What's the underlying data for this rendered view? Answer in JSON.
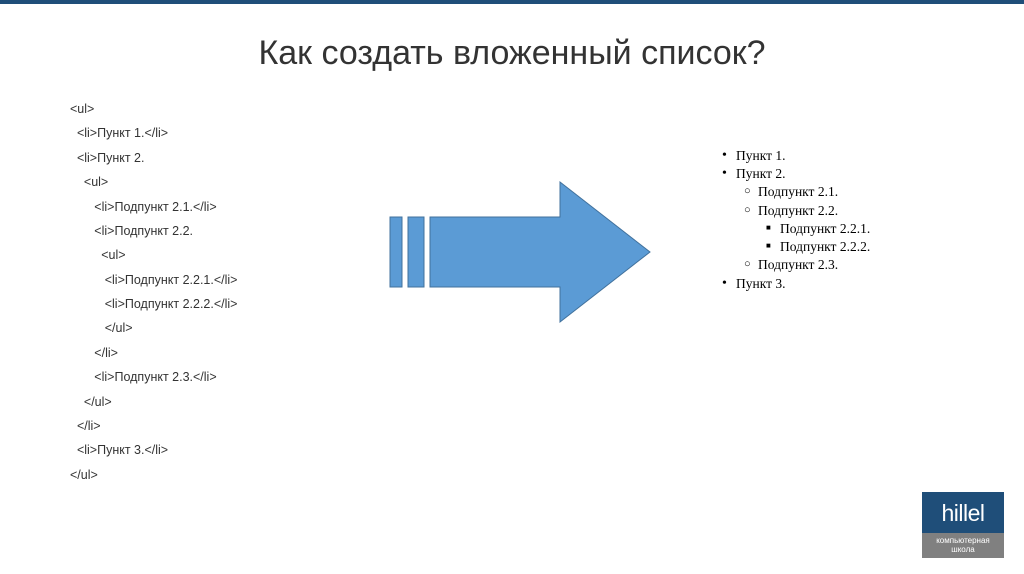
{
  "title": "Как создать вложенный список?",
  "code": {
    "l1": "<ul>",
    "l2": "  <li>Пункт 1.</li>",
    "l3": "  <li>Пункт 2.",
    "l4": "    <ul>",
    "l5": "       <li>Подпункт 2.1.</li>",
    "l6": "       <li>Подпункт 2.2.",
    "l7": "         <ul>",
    "l8": "          <li>Подпункт 2.2.1.</li>",
    "l9": "          <li>Подпункт 2.2.2.</li>",
    "l10": "          </ul>",
    "l11": "       </li>",
    "l12": "       <li>Подпункт 2.3.</li>",
    "l13": "    </ul>",
    "l14": "  </li>",
    "l15": "  <li>Пункт 3.</li>",
    "l16": "</ul>"
  },
  "result": {
    "p1": "Пункт 1.",
    "p2": "Пункт 2.",
    "s21": "Подпункт 2.1.",
    "s22": "Подпункт 2.2.",
    "s221": "Подпункт 2.2.1.",
    "s222": "Подпункт 2.2.2.",
    "s23": "Подпункт 2.3.",
    "p3": "Пункт 3."
  },
  "logo": {
    "name": "hillel",
    "sub": "компьютерная школа"
  },
  "colors": {
    "accent": "#1f4e79",
    "arrow_fill": "#5b9bd5",
    "arrow_stroke": "#41719c"
  }
}
